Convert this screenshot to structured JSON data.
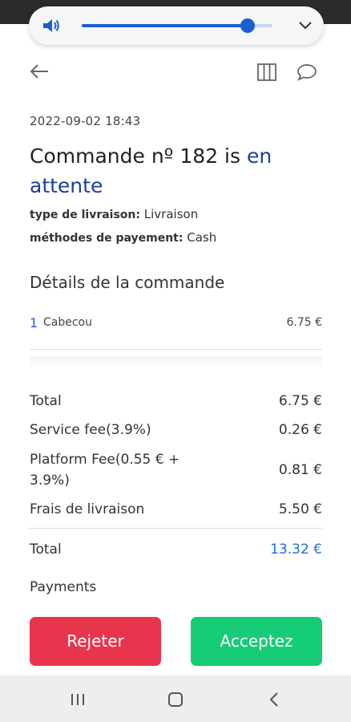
{
  "system": {
    "volume_level": 0.87,
    "accent_color": "#1a5fd0"
  },
  "toolbar": {
    "back_icon": "arrow-left-icon",
    "columns_icon": "columns-icon",
    "chat_icon": "chat-bubble-icon"
  },
  "order": {
    "date": "2022-09-02 18:43",
    "title_prefix": "Commande nº 182 is ",
    "status": "en attente",
    "status_color": "#1d3f9a",
    "delivery_label": "type de livraison:",
    "delivery_value": " Livraison",
    "payment_label": "méthodes de payement:",
    "payment_value": " Cash"
  },
  "details": {
    "section_title": "Détails de la commande",
    "items": [
      {
        "qty": "1",
        "name": "Cabecou",
        "price": "6.75 €"
      }
    ]
  },
  "summary": {
    "total_label": "Total",
    "total_value": "6.75 €",
    "service_label": "Service fee(3.9%)",
    "service_value": "0.26 €",
    "platform_label": "Platform Fee(0.55 € + 3.9%)",
    "platform_value": "0.81 €",
    "delivery_label": "Frais de livraison",
    "delivery_value": "5.50 €",
    "grand_label": "Total",
    "grand_value": "13.32 €"
  },
  "payments_label": "Payments",
  "actions": {
    "reject_label": "Rejeter",
    "accept_label": "Acceptez",
    "reject_color": "#e8354e",
    "accept_color": "#16cc77"
  },
  "nav": {
    "recents_icon": "recents-icon",
    "home_icon": "home-icon",
    "back_icon": "nav-back-icon"
  }
}
